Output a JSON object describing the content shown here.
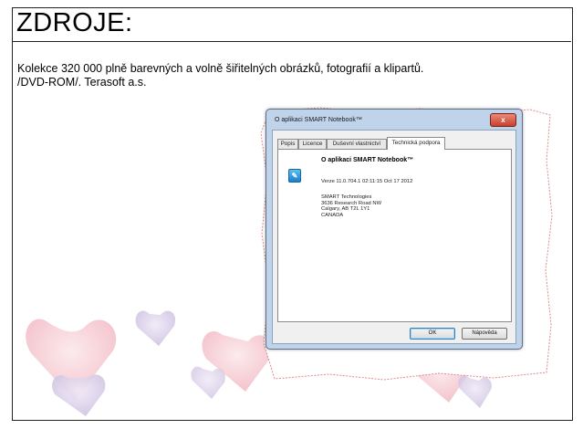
{
  "slide": {
    "title": "ZDROJE:",
    "body_line1": "Kolekce 320 000 plně barevných a volně šiřitelných obrázků, fotografií a klipartů.",
    "body_line2": "/DVD-ROM/. Terasoft a.s."
  },
  "dialog": {
    "window_title": "O aplikaci SMART Notebook™",
    "close_glyph": "x",
    "tabs": [
      "Popis",
      "Licence",
      "Duševní vlastnictví",
      "Technická podpora"
    ],
    "active_tab": "Technická podpora",
    "app_name": "O aplikaci SMART Notebook™",
    "version": "Verze 11.0.704.1 02:11:15 Oct 17 2012",
    "company": "SMART Technologies",
    "address1": "3636 Research Road NW",
    "address2": "Calgary, AB T2L 1Y1",
    "country": "CANADA",
    "ok_label": "OK",
    "help_label": "Nápověda"
  },
  "colors": {
    "heart_pink": "#f6c8cf",
    "heart_lilac": "#d9cfe6",
    "torn_edge": "#e08a8a"
  }
}
